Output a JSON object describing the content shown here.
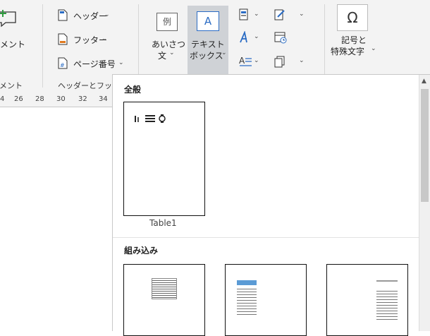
{
  "ribbon": {
    "comment": {
      "label": "コメント",
      "group": "コメント"
    },
    "header_footer": {
      "header_label": "ヘッダー",
      "footer_label": "フッター",
      "page_number_label": "ページ番号",
      "group": "ヘッダーとフッター"
    },
    "text": {
      "greeting_line1": "あいさつ",
      "greeting_line2": "文",
      "textbox_line1": "テキスト",
      "textbox_line2": "ボックス",
      "textbox_icon_glyph": "A",
      "greeting_icon_glyph": "例"
    },
    "symbol": {
      "line1": "記号と",
      "line2": "特殊文字",
      "icon_glyph": "Ω"
    }
  },
  "ruler": {
    "ticks": [
      "4",
      "26",
      "28",
      "30",
      "32",
      "34"
    ]
  },
  "gallery": {
    "section_general": "全般",
    "section_builtin": "組み込み",
    "general_items": [
      {
        "caption": "Table1"
      }
    ],
    "builtin_item_count": 3
  },
  "colors": {
    "accent": "#2b6cc4",
    "ribbon_bg": "#f3f3f3",
    "selected_bg": "#cfd2d6"
  }
}
